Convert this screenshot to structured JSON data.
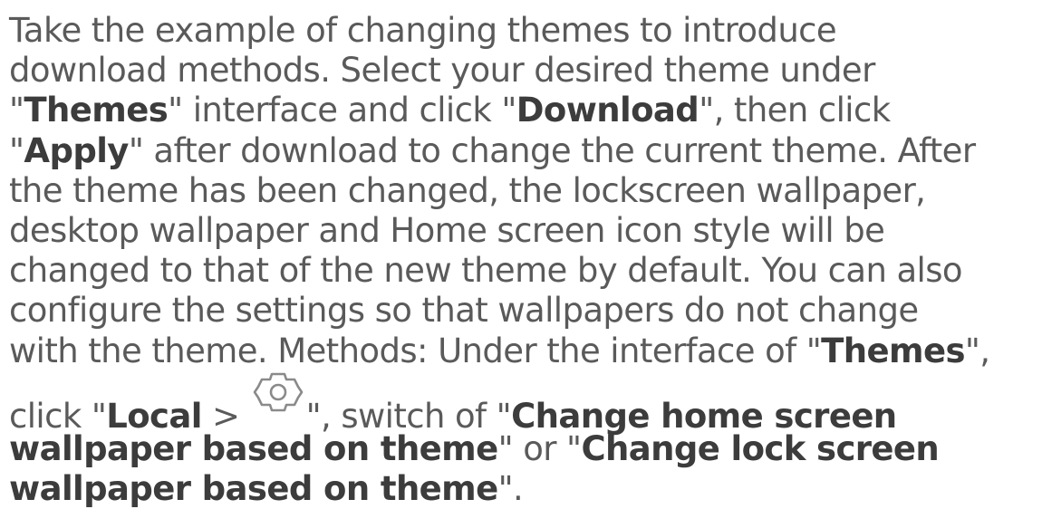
{
  "paragraph": {
    "l1": "Take the example of changing themes to introduce",
    "l2": "download methods. Select your desired theme under",
    "l3_q1": "\"",
    "l3_b1": "Themes",
    "l3_t1": "\" interface and click \"",
    "l3_b2": "Download",
    "l3_t2": "\", then click",
    "l4_q1": "\"",
    "l4_b1": "Apply",
    "l4_t1": "\" after download to change the current theme. After",
    "l5": "the theme has been changed, the lockscreen wallpaper,",
    "l6": "desktop wallpaper and Home screen icon style will be",
    "l7": "changed to that of the new theme by default. You can also",
    "l8": "configure the settings so that wallpapers do not change",
    "l9_t1": "with the theme. Methods: Under the interface of \"",
    "l9_b1": "Themes",
    "l9_t2": "\",",
    "l10_t1": "click \"",
    "l10_b1": "Local",
    "l10_t2": " > ",
    "l10_t3": "\", switch of \"",
    "l10_b2": "Change home screen",
    "l11_b1": "wallpaper based on theme",
    "l11_t1": "\" or \"",
    "l11_b2": "Change lock screen",
    "l12_b1": "wallpaper based on theme",
    "l12_t1": "\"."
  },
  "icons": {
    "settings": "gear-icon"
  },
  "colors": {
    "text": "#5a5a5a",
    "bold_text": "#3c3c3c",
    "icon_stroke": "#8a8a8a"
  }
}
